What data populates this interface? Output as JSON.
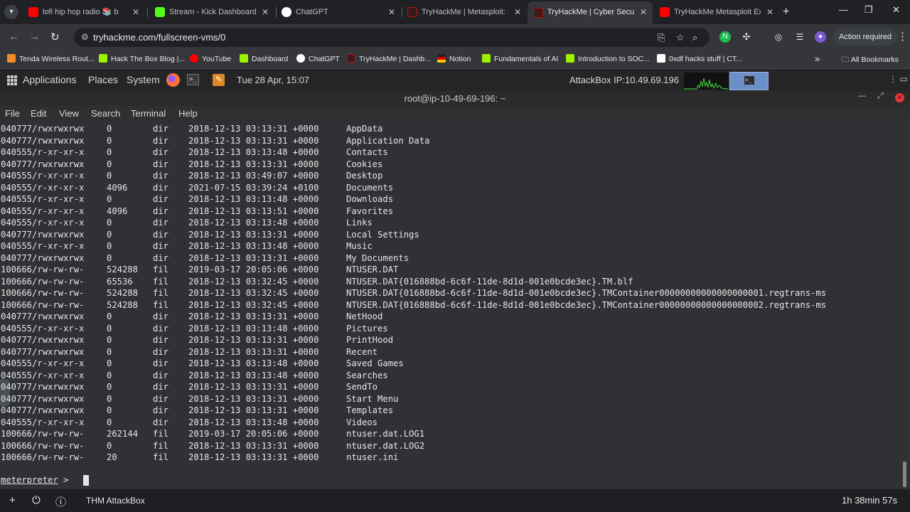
{
  "browser": {
    "tabs": [
      {
        "title": "lofi hip hop radio 📚 b",
        "color": "#ff0000"
      },
      {
        "title": "Stream - Kick Dashboard",
        "color": "#53fc18"
      },
      {
        "title": "ChatGPT",
        "color": "#ffffff"
      },
      {
        "title": "TryHackMe | Metasploit: Ex",
        "color": "#c11111"
      },
      {
        "title": "TryHackMe | Cyber Security",
        "color": "#c11111"
      },
      {
        "title": "TryHackMe Metasploit Exp",
        "color": "#ff0000"
      }
    ],
    "url": "tryhackme.com/fullscreen-vms/0",
    "action_required": "Action required",
    "bookmarks": [
      {
        "label": "Tenda Wireless Rout...",
        "color": "#f28b25"
      },
      {
        "label": "Hack The Box Blog |...",
        "color": "#9fef00"
      },
      {
        "label": "YouTube",
        "color": "#ff0000"
      },
      {
        "label": "Dashboard",
        "color": "#9fef00"
      },
      {
        "label": "ChatGPT",
        "color": "#ffffff"
      },
      {
        "label": "TryHackMe | Dashb...",
        "color": "#c11111"
      },
      {
        "label": "Notion",
        "color": "#e8a33d"
      },
      {
        "label": "Fundamentals of AI",
        "color": "#9fef00"
      },
      {
        "label": "Introduction to SOC...",
        "color": "#9fef00"
      },
      {
        "label": "0xdf hacks stuff | CT...",
        "color": "#ffffff"
      }
    ],
    "all_bookmarks": "All Bookmarks"
  },
  "desktop_panel": {
    "applications": "Applications",
    "places": "Places",
    "system": "System",
    "datetime": "Tue 28 Apr, 15:07",
    "attackbox_ip": "AttackBox IP:10.49.69.196"
  },
  "terminal": {
    "title": "root@ip-10-49-69-196: ~",
    "menu": [
      "File",
      "Edit",
      "View",
      "Search",
      "Terminal",
      "Help"
    ],
    "rows": [
      [
        "040777/rwxrwxrwx",
        "0",
        "dir",
        "2018-12-13 03:13:31 +0000",
        "AppData"
      ],
      [
        "040777/rwxrwxrwx",
        "0",
        "dir",
        "2018-12-13 03:13:31 +0000",
        "Application Data"
      ],
      [
        "040555/r-xr-xr-x",
        "0",
        "dir",
        "2018-12-13 03:13:48 +0000",
        "Contacts"
      ],
      [
        "040777/rwxrwxrwx",
        "0",
        "dir",
        "2018-12-13 03:13:31 +0000",
        "Cookies"
      ],
      [
        "040555/r-xr-xr-x",
        "0",
        "dir",
        "2018-12-13 03:49:07 +0000",
        "Desktop"
      ],
      [
        "040555/r-xr-xr-x",
        "4096",
        "dir",
        "2021-07-15 03:39:24 +0100",
        "Documents"
      ],
      [
        "040555/r-xr-xr-x",
        "0",
        "dir",
        "2018-12-13 03:13:48 +0000",
        "Downloads"
      ],
      [
        "040555/r-xr-xr-x",
        "4096",
        "dir",
        "2018-12-13 03:13:51 +0000",
        "Favorites"
      ],
      [
        "040555/r-xr-xr-x",
        "0",
        "dir",
        "2018-12-13 03:13:48 +0000",
        "Links"
      ],
      [
        "040777/rwxrwxrwx",
        "0",
        "dir",
        "2018-12-13 03:13:31 +0000",
        "Local Settings"
      ],
      [
        "040555/r-xr-xr-x",
        "0",
        "dir",
        "2018-12-13 03:13:48 +0000",
        "Music"
      ],
      [
        "040777/rwxrwxrwx",
        "0",
        "dir",
        "2018-12-13 03:13:31 +0000",
        "My Documents"
      ],
      [
        "100666/rw-rw-rw-",
        "524288",
        "fil",
        "2019-03-17 20:05:06 +0000",
        "NTUSER.DAT"
      ],
      [
        "100666/rw-rw-rw-",
        "65536",
        "fil",
        "2018-12-13 03:32:45 +0000",
        "NTUSER.DAT{016888bd-6c6f-11de-8d1d-001e0bcde3ec}.TM.blf"
      ],
      [
        "100666/rw-rw-rw-",
        "524288",
        "fil",
        "2018-12-13 03:32:45 +0000",
        "NTUSER.DAT{016888bd-6c6f-11de-8d1d-001e0bcde3ec}.TMContainer00000000000000000001.regtrans-ms"
      ],
      [
        "100666/rw-rw-rw-",
        "524288",
        "fil",
        "2018-12-13 03:32:45 +0000",
        "NTUSER.DAT{016888bd-6c6f-11de-8d1d-001e0bcde3ec}.TMContainer00000000000000000002.regtrans-ms"
      ],
      [
        "040777/rwxrwxrwx",
        "0",
        "dir",
        "2018-12-13 03:13:31 +0000",
        "NetHood"
      ],
      [
        "040555/r-xr-xr-x",
        "0",
        "dir",
        "2018-12-13 03:13:48 +0000",
        "Pictures"
      ],
      [
        "040777/rwxrwxrwx",
        "0",
        "dir",
        "2018-12-13 03:13:31 +0000",
        "PrintHood"
      ],
      [
        "040777/rwxrwxrwx",
        "0",
        "dir",
        "2018-12-13 03:13:31 +0000",
        "Recent"
      ],
      [
        "040555/r-xr-xr-x",
        "0",
        "dir",
        "2018-12-13 03:13:48 +0000",
        "Saved Games"
      ],
      [
        "040555/r-xr-xr-x",
        "0",
        "dir",
        "2018-12-13 03:13:48 +0000",
        "Searches"
      ],
      [
        "040777/rwxrwxrwx",
        "0",
        "dir",
        "2018-12-13 03:13:31 +0000",
        "SendTo"
      ],
      [
        "040777/rwxrwxrwx",
        "0",
        "dir",
        "2018-12-13 03:13:31 +0000",
        "Start Menu"
      ],
      [
        "040777/rwxrwxrwx",
        "0",
        "dir",
        "2018-12-13 03:13:31 +0000",
        "Templates"
      ],
      [
        "040555/r-xr-xr-x",
        "0",
        "dir",
        "2018-12-13 03:13:48 +0000",
        "Videos"
      ],
      [
        "100666/rw-rw-rw-",
        "262144",
        "fil",
        "2019-03-17 20:05:06 +0000",
        "ntuser.dat.LOG1"
      ],
      [
        "100666/rw-rw-rw-",
        "0",
        "fil",
        "2018-12-13 03:13:31 +0000",
        "ntuser.dat.LOG2"
      ],
      [
        "100666/rw-rw-rw-",
        "20",
        "fil",
        "2018-12-13 03:13:31 +0000",
        "ntuser.ini"
      ]
    ],
    "prompt_word": "meterpreter",
    "prompt_suffix": " > "
  },
  "bottom_bar": {
    "label": "THM AttackBox",
    "timer": "1h 38min 57s"
  }
}
